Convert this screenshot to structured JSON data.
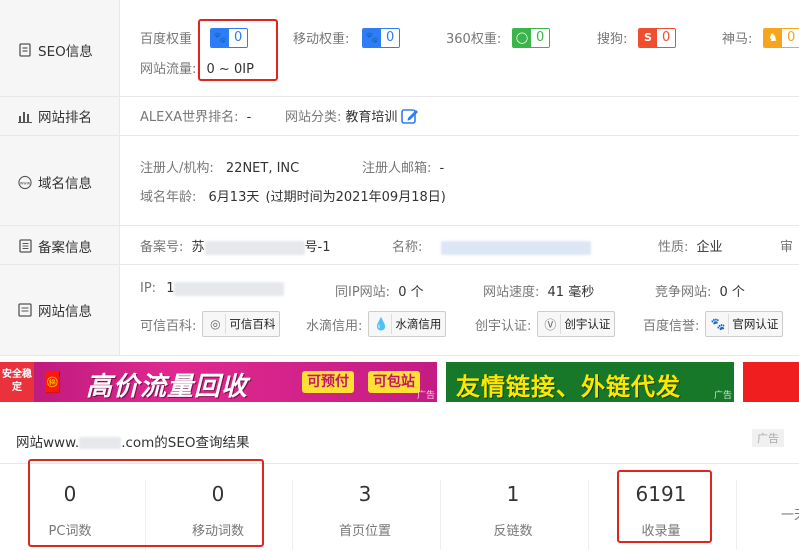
{
  "seo": {
    "section_label": "SEO信息",
    "baidu_label": "百度权重",
    "baidu_value": "0",
    "mobile_label": "移动权重:",
    "mobile_value": "0",
    "s360_label": "360权重:",
    "s360_value": "0",
    "sogou_label": "搜狗:",
    "sogou_value": "0",
    "shenma_label": "神马:",
    "shenma_value": "0",
    "traffic_label": "网站流量:",
    "traffic_value": "0 ~ 0IP"
  },
  "ranking": {
    "section_label": "网站排名",
    "alexa_label": "ALEXA世界排名:",
    "alexa_value": "-",
    "category_label": "网站分类:",
    "category_value": "教育培训"
  },
  "domain": {
    "section_label": "域名信息",
    "registrant_label": "注册人/机构:",
    "registrant_value": "22NET, INC",
    "email_label": "注册人邮箱:",
    "email_value": "-",
    "age_label": "域名年龄:",
    "age_value": "6月13天",
    "expiry_note": "(过期时间为2021年09月18日)"
  },
  "icp": {
    "section_label": "备案信息",
    "number_label": "备案号:",
    "number_prefix": "苏",
    "number_suffix": "号-1",
    "name_label": "名称:",
    "nature_label": "性质:",
    "nature_value": "企业",
    "review_label": "审"
  },
  "site": {
    "section_label": "网站信息",
    "ip_label": "IP:",
    "ip_prefix": "1",
    "same_ip_label": "同IP网站:",
    "same_ip_value": "0 个",
    "speed_label": "网站速度:",
    "speed_value": "41 毫秒",
    "competitor_label": "竞争网站:",
    "competitor_value": "0 个",
    "kexin_label": "可信百科:",
    "kexin_badge": "可信百科",
    "shuidi_label": "水滴信用:",
    "shuidi_badge": "水滴信用",
    "chuangyu_label": "创宇认证:",
    "chuangyu_badge": "创宇认证",
    "baidu_xinyu_label": "百度信誉:",
    "baidu_xinyu_badge": "官网认证"
  },
  "ads": {
    "banner1_corner": "安全稳定",
    "banner1_text": "高价流量回收",
    "banner1_btn1": "可预付",
    "banner1_btn2": "可包站",
    "banner1_tag": "广告",
    "banner2_text": "友情链接、外链代发",
    "banner2_tag": "广告"
  },
  "result": {
    "title_prefix": "网站www.",
    "title_suffix": ".com的SEO查询结果",
    "ad_tag": "广告"
  },
  "stats": [
    {
      "value": "0",
      "label": "PC词数"
    },
    {
      "value": "0",
      "label": "移动词数"
    },
    {
      "value": "3",
      "label": "首页位置"
    },
    {
      "value": "1",
      "label": "反链数"
    },
    {
      "value": "6191",
      "label": "收录量"
    },
    {
      "value": "",
      "label": "一天"
    }
  ],
  "colors": {
    "highlight": "#e0251f",
    "baidu_blue": "#2f7df6",
    "s360_green": "#39b54a",
    "sogou_red": "#f04e30",
    "shenma_orange": "#f7a51c",
    "banner1_bg": "#d61f8c",
    "banner2_bg": "#1d7f2b"
  }
}
